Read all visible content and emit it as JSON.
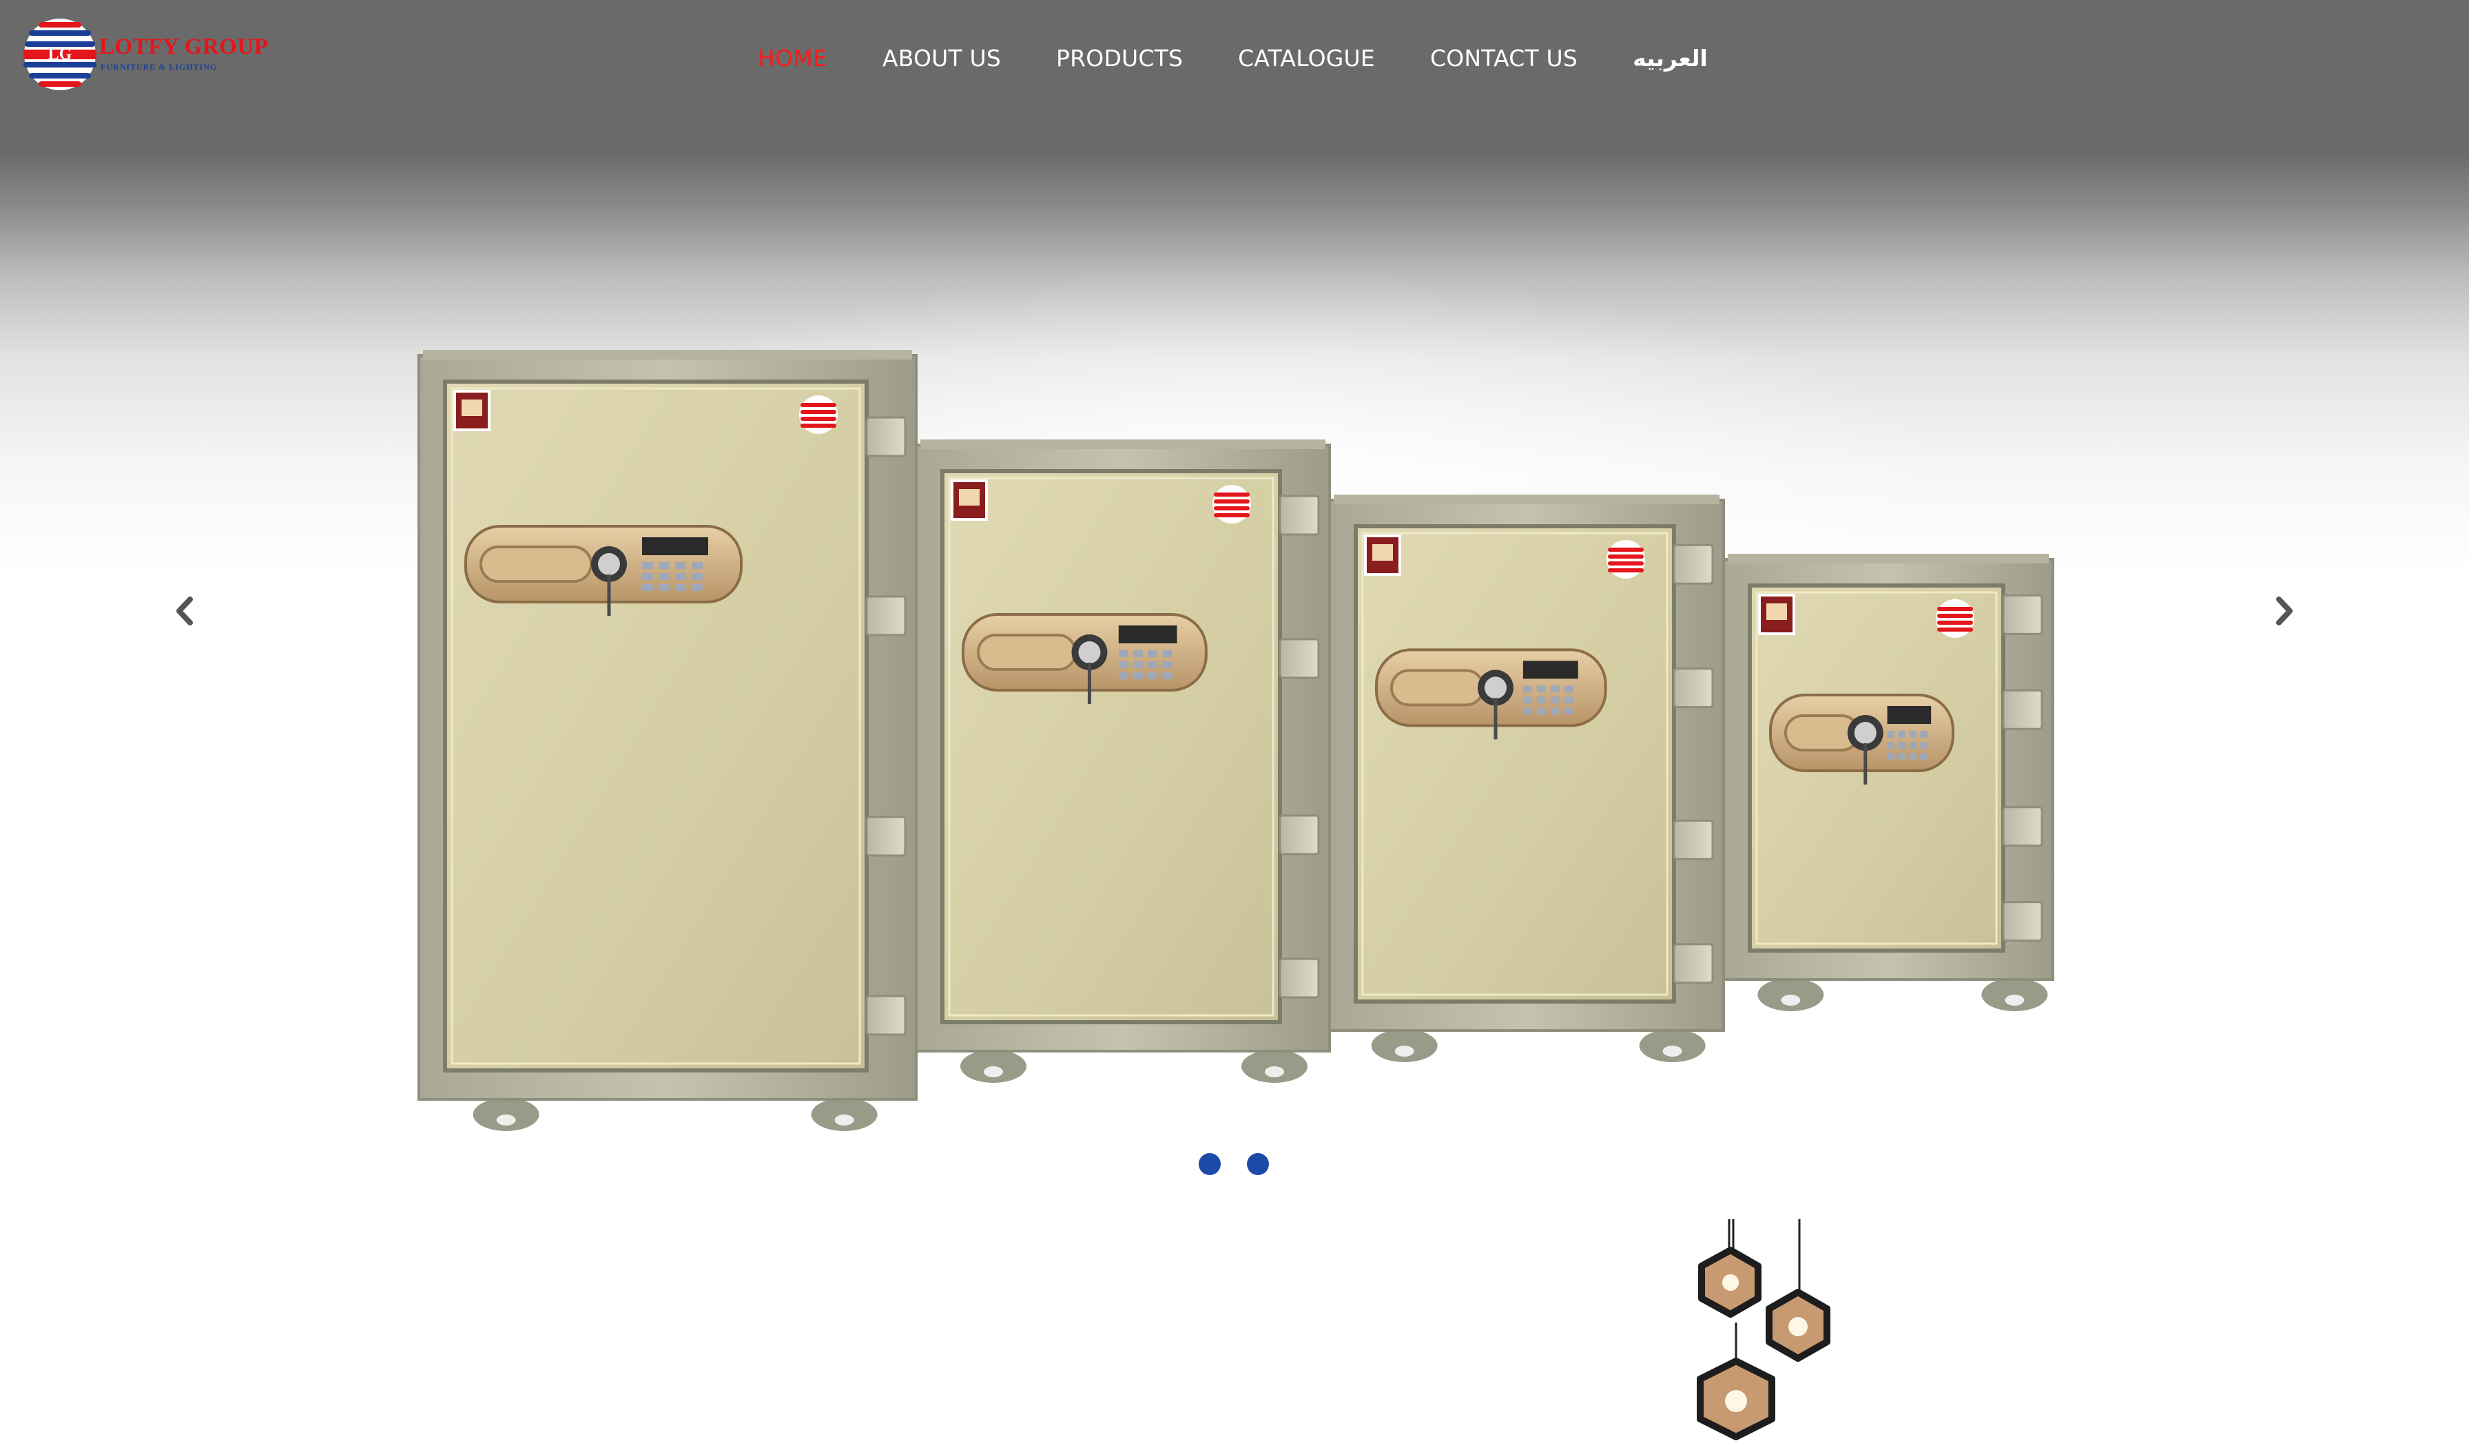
{
  "logo": {
    "title": "LOTFY GROUP",
    "subtitle": "FURNITURE & LIGHTING",
    "emblem_text": "LG",
    "colors": {
      "red": "#e4161b",
      "blue": "#1b3f96"
    }
  },
  "nav": {
    "items": [
      {
        "label": "HOME",
        "active": true
      },
      {
        "label": "ABOUT US",
        "active": false
      },
      {
        "label": "PRODUCTS",
        "active": false
      },
      {
        "label": "CATALOGUE",
        "active": false
      },
      {
        "label": "CONTACT US",
        "active": false
      },
      {
        "label": "العربيه",
        "active": false
      }
    ],
    "active_color": "#ff1a1a"
  },
  "slider": {
    "image_subject": "four beige fire-proof safes with digital keypads",
    "prev_icon": "chevron-left-icon",
    "next_icon": "chevron-right-icon",
    "slide_count": 2,
    "dot_color": "#1b4aa8"
  },
  "decor": {
    "lamps_icon": "pendant-lamps-icon"
  }
}
